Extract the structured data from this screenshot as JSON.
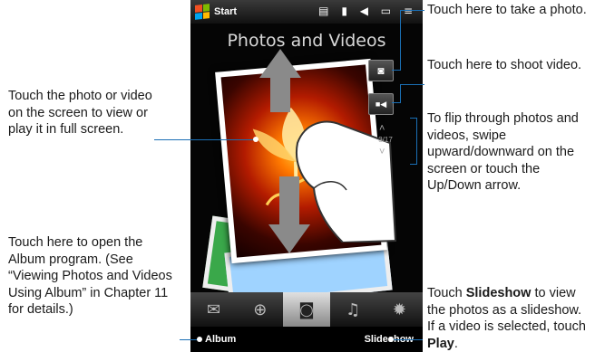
{
  "phone": {
    "status_start": "Start",
    "status_icons": "▤ ▮ ◀ ▭ ≡",
    "screen_title": "Photos and Videos",
    "photo_counter": "3/17",
    "tabs": [
      {
        "icon": "mail-icon",
        "glyph": "✉"
      },
      {
        "icon": "globe-icon",
        "glyph": "⊕"
      },
      {
        "icon": "camera-tab-icon",
        "glyph": "◙"
      },
      {
        "icon": "music-icon",
        "glyph": "♫"
      },
      {
        "icon": "settings-icon",
        "glyph": "✹"
      }
    ],
    "left_softkey": "Album",
    "right_softkey": "Slideshow",
    "camera_glyph": "◙",
    "video_glyph": "■◀",
    "up_arrow_glyph": "˄",
    "down_arrow_glyph": "˅"
  },
  "callouts": {
    "take_photo": "Touch here to take a photo.",
    "shoot_video": "Touch here to shoot video.",
    "flip": "To flip through photos and videos, swipe upward/downward on the screen or touch the Up/Down arrow.",
    "view_photo": "Touch the photo or video on the screen to view or play it in full screen.",
    "album_line1": "Touch here to open the Album program. (See “Viewing Photos and Videos Using Album” in Chapter 11 for details.)",
    "slideshow_prefix": "Touch ",
    "slideshow_bold": "Slideshow",
    "slideshow_mid": " to view the photos as a slideshow. If a video is selected, touch ",
    "slideshow_play": "Play",
    "slideshow_end": "."
  },
  "colors": {
    "leader_line": "#1a6fb5",
    "flame": "#ff7a00"
  }
}
